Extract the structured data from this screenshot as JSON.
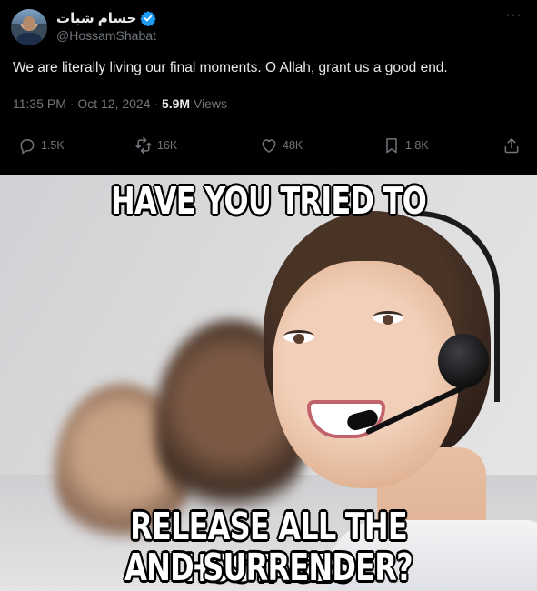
{
  "tweet": {
    "display_name": "حسام شبات",
    "handle": "@HossamShabat",
    "more_label": "···",
    "text": "We are literally living our final moments. O Allah, grant us a good end.",
    "timestamp": "11:35 PM · Oct 12, 2024 · ",
    "views_count": "5.9M",
    "views_label": " Views",
    "actions": {
      "reply_count": "1.5K",
      "repost_count": "16K",
      "like_count": "48K",
      "bookmark_count": "1.8K"
    },
    "icons": [
      "verified-badge-icon",
      "more-icon",
      "reply-icon",
      "repost-icon",
      "like-icon",
      "bookmark-icon",
      "share-icon"
    ],
    "colors": {
      "background": "#000000",
      "text": "#e7e9ea",
      "muted": "#71767b",
      "verified": "#1d9bf0"
    }
  },
  "meme": {
    "top_caption": "HAVE YOU TRIED TO",
    "bottom_caption_line1": "RELEASE ALL THE HOSTAGES",
    "bottom_caption_line2": "AND SURRENDER?"
  }
}
